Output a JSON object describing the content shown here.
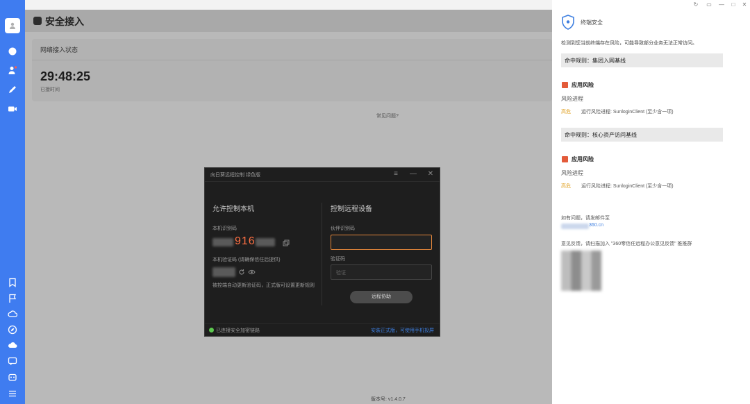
{
  "app": {
    "title": "安全接入"
  },
  "status": {
    "label": "网络接入状态",
    "timer": "29:48:25",
    "timer_label": "已接时间"
  },
  "main": {
    "faq": "常见问题?",
    "version": "版本号: v1.4.0.7"
  },
  "dialog": {
    "title": "向日葵远程控制 绿色版",
    "allow_title": "允许控制本机",
    "control_title": "控制远程设备",
    "device_id_label": "本机识别码",
    "device_id_visible": "916",
    "verify_label": "本机验证码 (请确保信任后提供)",
    "hint": "被控端自动更新验证码，正式版可设置更新规则",
    "partner_label": "伙伴识别码",
    "code_label": "验证码",
    "code_placeholder": "验证",
    "remote_button": "远程协助",
    "secure_text": "已连接安全加密链路",
    "footer_link": "安装正式版，可使用手机投屏"
  },
  "panel": {
    "title": "终端安全",
    "description": "检测到您当前终端存在风险，可能导致部分业务无法正常访问。",
    "rules": [
      {
        "name": "命中规则：集团入网基线",
        "risk_title": "应用风险",
        "risk_sub": "风险进程",
        "level": "高危",
        "detail": "运行风险进程: SunloginClient (至少含一项)"
      },
      {
        "name": "命中规则：核心资产访问基线",
        "risk_title": "应用风险",
        "risk_sub": "风险进程",
        "level": "高危",
        "detail": "运行风险进程: SunloginClient (至少含一项)"
      }
    ],
    "contact": "如有问题，请发邮件至",
    "email_visible": "360.cn",
    "feedback": "意见反馈，请扫描加入 \"360零信任远程办公意见反馈\" 推推群"
  },
  "colors": {
    "sidebar": "#3f7cf0",
    "accent_orange": "#ff7043",
    "risk_level": "#e0a224",
    "link_blue": "#3e7fe0",
    "secure_green": "#5cc84f"
  }
}
